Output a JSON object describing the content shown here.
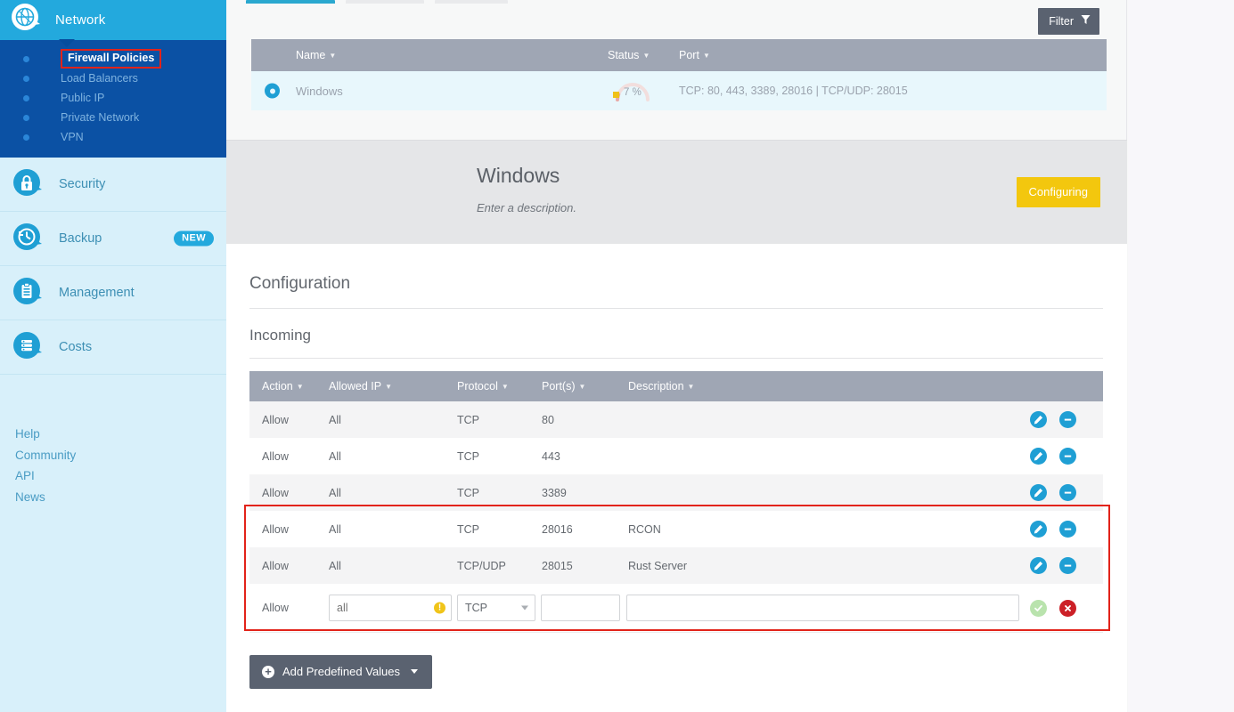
{
  "sidebar": {
    "header": {
      "label": "Network",
      "icon": "globe-network-icon"
    },
    "subitems": [
      {
        "label": "Firewall Policies",
        "active": true
      },
      {
        "label": "Load Balancers",
        "active": false
      },
      {
        "label": "Public IP",
        "active": false
      },
      {
        "label": "Private Network",
        "active": false
      },
      {
        "label": "VPN",
        "active": false
      }
    ],
    "sections": [
      {
        "label": "Security",
        "icon": "lock-icon",
        "badge": ""
      },
      {
        "label": "Backup",
        "icon": "clock-restore-icon",
        "badge": "NEW"
      },
      {
        "label": "Management",
        "icon": "clipboard-icon",
        "badge": ""
      },
      {
        "label": "Costs",
        "icon": "coins-icon",
        "badge": ""
      }
    ],
    "links": [
      "Help",
      "Community",
      "API",
      "News"
    ]
  },
  "toolbar": {
    "filter_label": "Filter",
    "filter_icon": "funnel-icon"
  },
  "policies_table": {
    "columns": [
      "Name",
      "Status",
      "Port"
    ],
    "rows": [
      {
        "name": "Windows",
        "selected": true,
        "status_value": "7 %",
        "ports": "TCP: 80, 443, 3389, 28016 | TCP/UDP: 28015"
      }
    ]
  },
  "detail": {
    "title": "Windows",
    "description_placeholder": "Enter a description.",
    "status_badge": "Configuring"
  },
  "configuration": {
    "heading": "Configuration",
    "subheading": "Incoming",
    "columns": [
      "Action",
      "Allowed IP",
      "Protocol",
      "Port(s)",
      "Description"
    ],
    "rules": [
      {
        "action": "Allow",
        "ip": "All",
        "protocol": "TCP",
        "ports": "80",
        "description": ""
      },
      {
        "action": "Allow",
        "ip": "All",
        "protocol": "TCP",
        "ports": "443",
        "description": ""
      },
      {
        "action": "Allow",
        "ip": "All",
        "protocol": "TCP",
        "ports": "3389",
        "description": ""
      },
      {
        "action": "Allow",
        "ip": "All",
        "protocol": "TCP",
        "ports": "28016",
        "description": "RCON"
      },
      {
        "action": "Allow",
        "ip": "All",
        "protocol": "TCP/UDP",
        "ports": "28015",
        "description": "Rust Server"
      }
    ],
    "new_rule": {
      "action": "Allow",
      "ip_value": "",
      "ip_placeholder": "all",
      "protocol_value": "TCP",
      "ports_value": "",
      "ports_placeholder": "",
      "description_value": "",
      "description_placeholder": ""
    },
    "add_button": "Add Predefined Values"
  },
  "colors": {
    "brand_cyan": "#23a9dd",
    "nav_blue": "#0b51a4",
    "sidebar_light": "#d8f0fa",
    "table_header_gray": "#9fa6b4",
    "badge_yellow": "#f3c70e",
    "highlight_red": "#e2231a",
    "button_slate": "#5a6270"
  }
}
